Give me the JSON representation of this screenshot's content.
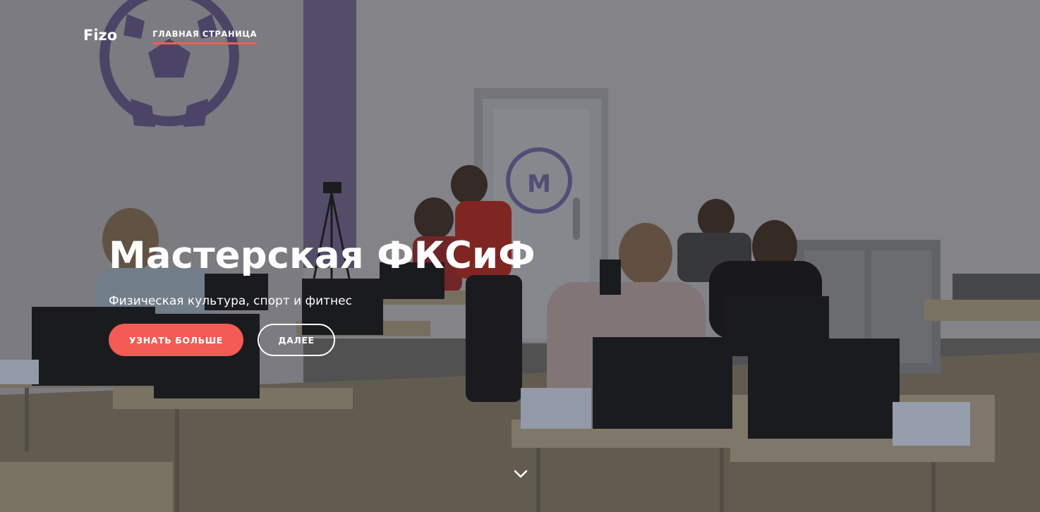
{
  "navbar": {
    "brand": "Fizo",
    "links": [
      {
        "label": "ГЛАВНАЯ СТРАНИЦА",
        "active": true
      }
    ]
  },
  "hero": {
    "title": "Мастерская ФКСиФ",
    "subtitle": "Физическая культура, спорт и фитнес",
    "primary_button": "УЗНАТЬ БОЛЬШЕ",
    "secondary_button": "ДАЛЕЕ",
    "scroll_icon": "chevron-down-icon"
  },
  "colors": {
    "accent": "#f25c54",
    "text": "#ffffff",
    "wall": "#c9c9cc",
    "floor": "#8c8372"
  }
}
